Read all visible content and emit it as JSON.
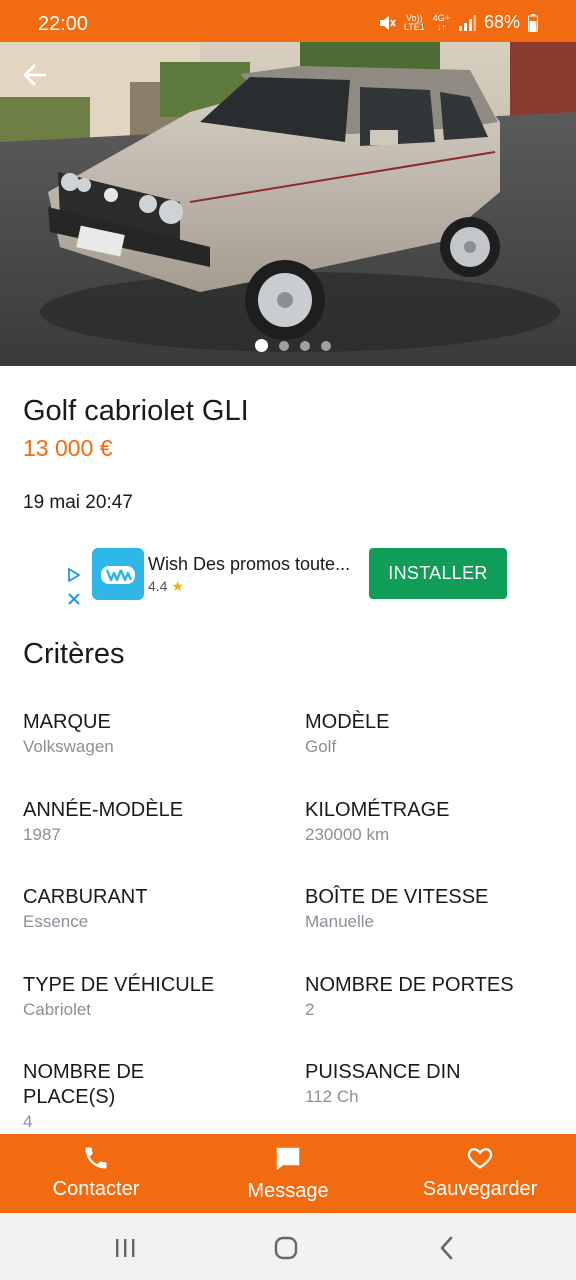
{
  "status_bar": {
    "time": "22:00",
    "net_top": "Vo))",
    "net_bottom": "LTE1",
    "gen_top": "4G+",
    "battery": "68%"
  },
  "gallery": {
    "image_count": 4,
    "active_index": 0
  },
  "listing": {
    "title": "Golf cabriolet GLI",
    "price": "13 000 €",
    "date": "19 mai 20:47"
  },
  "ad": {
    "title": "Wish Des promos toute...",
    "rating": "4.4",
    "button_label": "INSTALLER"
  },
  "criteria": {
    "heading": "Critères",
    "items": [
      {
        "label": "MARQUE",
        "value": "Volkswagen"
      },
      {
        "label": "MODÈLE",
        "value": "Golf"
      },
      {
        "label": "ANNÉE-MODÈLE",
        "value": "1987"
      },
      {
        "label": "KILOMÉTRAGE",
        "value": "230000 km"
      },
      {
        "label": "CARBURANT",
        "value": "Essence"
      },
      {
        "label": "BOÎTE DE VITESSE",
        "value": "Manuelle"
      },
      {
        "label": "TYPE DE VÉHICULE",
        "value": "Cabriolet"
      },
      {
        "label": "NOMBRE DE PORTES",
        "value": "2"
      },
      {
        "label": "NOMBRE DE PLACE(S)",
        "value": "4"
      },
      {
        "label": "PUISSANCE DIN",
        "value": "112 Ch"
      }
    ]
  },
  "actions": {
    "contact": "Contacter",
    "message": "Message",
    "save": "Sauvegarder"
  },
  "colors": {
    "accent": "#f36b10",
    "install": "#0f9d58",
    "muted": "#8a9097"
  }
}
